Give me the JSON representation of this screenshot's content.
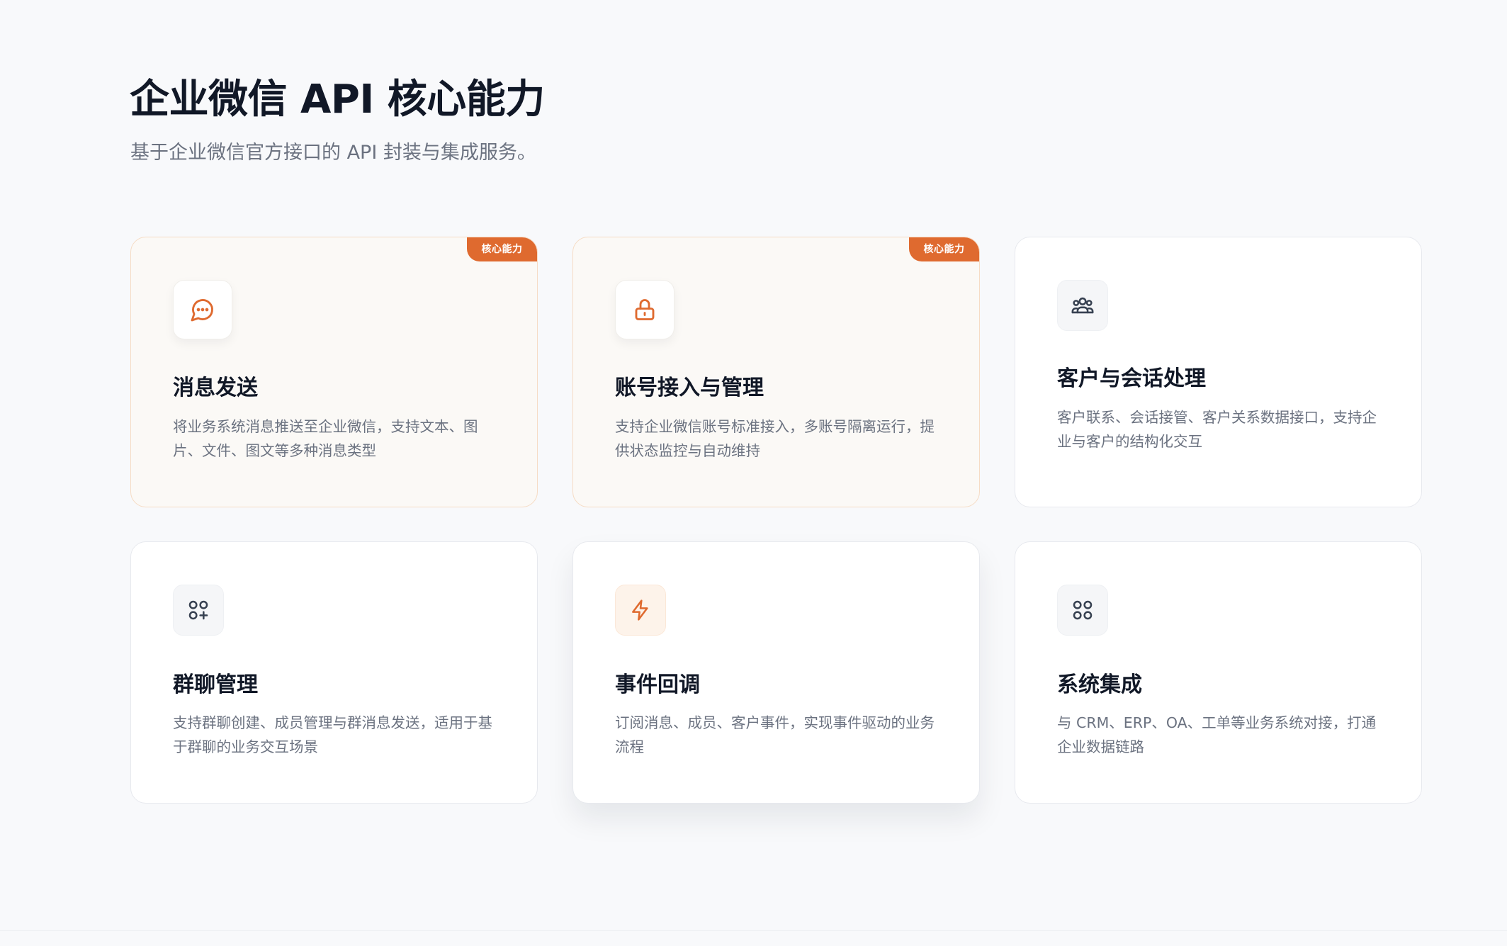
{
  "header": {
    "title": "企业微信 API 核心能力",
    "subtitle": "基于企业微信官方接口的 API 封装与集成服务。"
  },
  "colors": {
    "accent": "#df6a2f",
    "title": "#111827",
    "text_muted": "#6b7280",
    "icon_dark": "#374151"
  },
  "cards": [
    {
      "title": "消息发送",
      "description": "将业务系统消息推送至企业微信，支持文本、图片、文件、图文等多种消息类型",
      "badge": "核心能力",
      "icon": "chat-bubble-icon"
    },
    {
      "title": "账号接入与管理",
      "description": "支持企业微信账号标准接入，多账号隔离运行，提供状态监控与自动维持",
      "badge": "核心能力",
      "icon": "lock-icon"
    },
    {
      "title": "客户与会话处理",
      "description": "客户联系、会话接管、客户关系数据接口，支持企业与客户的结构化交互",
      "icon": "users-group-icon"
    },
    {
      "title": "群聊管理",
      "description": "支持群聊创建、成员管理与群消息发送，适用于基于群聊的业务交互场景",
      "icon": "grid-plus-icon"
    },
    {
      "title": "事件回调",
      "description": "订阅消息、成员、客户事件，实现事件驱动的业务流程",
      "icon": "lightning-icon"
    },
    {
      "title": "系统集成",
      "description": "与 CRM、ERP、OA、工单等业务系统对接，打通企业数据链路",
      "icon": "grid-icon"
    }
  ]
}
